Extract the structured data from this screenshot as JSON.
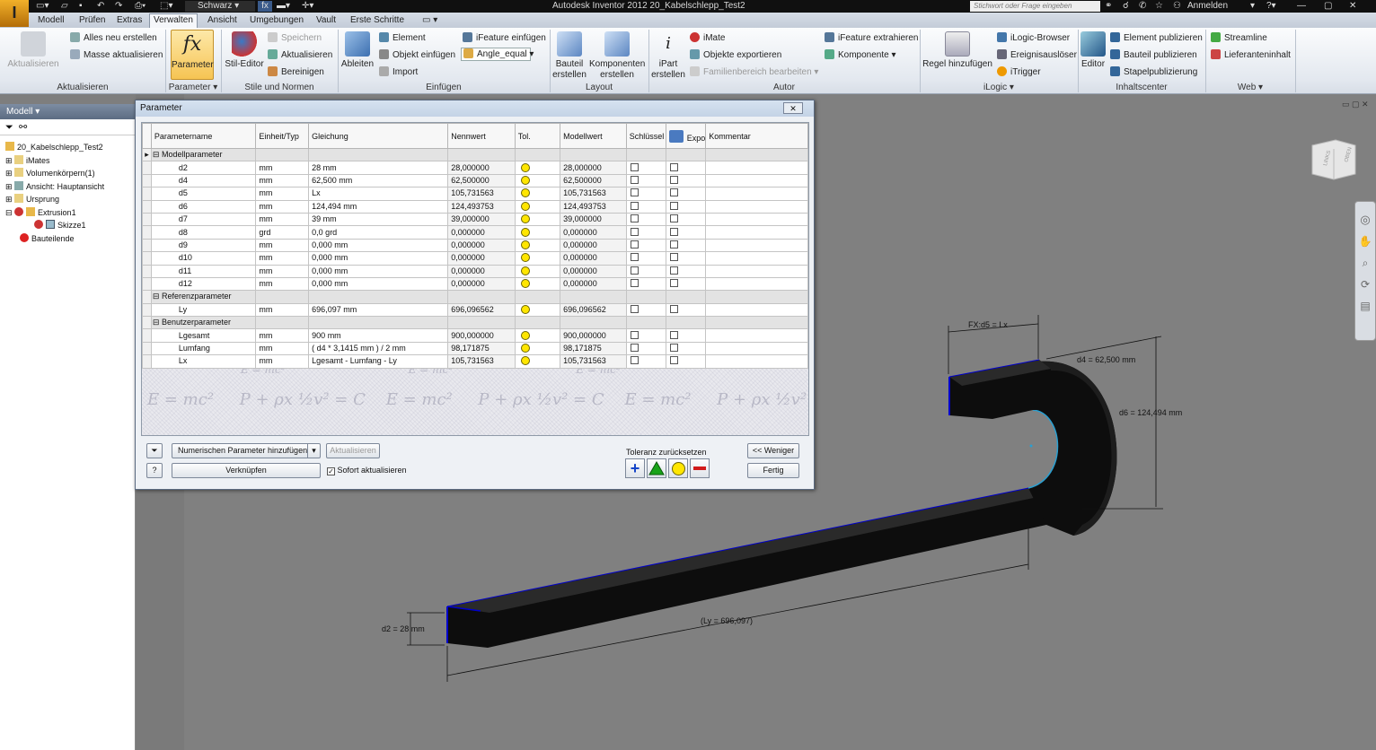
{
  "window": {
    "title": "Autodesk Inventor 2012  20_Kabelschlepp_Test2",
    "search_placeholder": "Stichwort oder Frage eingeben",
    "signin": "Anmelden"
  },
  "quick_access": {
    "color_value": "Schwarz"
  },
  "tabs": [
    {
      "label": "Modell"
    },
    {
      "label": "Prüfen"
    },
    {
      "label": "Extras"
    },
    {
      "label": "Verwalten"
    },
    {
      "label": "Ansicht"
    },
    {
      "label": "Umgebungen"
    },
    {
      "label": "Vault"
    },
    {
      "label": "Erste Schritte"
    }
  ],
  "ribbon": {
    "aktualisieren": {
      "big": "Aktualisieren",
      "alles": "Alles neu erstellen",
      "masse": "Masse aktualisieren",
      "group": "Aktualisieren"
    },
    "parameter": {
      "big": "Parameter",
      "group": "Parameter"
    },
    "stile": {
      "big": "Stil-Editor",
      "speichern": "Speichern",
      "aktualisieren": "Aktualisieren",
      "bereinigen": "Bereinigen",
      "group": "Stile und Normen"
    },
    "einfuegen": {
      "big": "Ableiten",
      "element": "Element",
      "objekt": "Objekt einfügen",
      "import": "Import",
      "ifeature": "iFeature einfügen",
      "angle": "Angle_equal",
      "group": "Einfügen"
    },
    "layout": {
      "bauteil": "Bauteil\nerstellen",
      "komponenten": "Komponenten\nerstellen",
      "group": "Layout"
    },
    "autor": {
      "ipart": "iPart\nerstellen",
      "imate": "iMate",
      "objekte": "Objekte exportieren",
      "familien": "Familienbereich bearbeiten",
      "ifeature_ex": "iFeature extrahieren",
      "komponente": "Komponente",
      "group": "Autor"
    },
    "ilogic": {
      "regel": "Regel hinzufügen",
      "browser": "iLogic-Browser",
      "ereignis": "Ereignisauslöser",
      "itrigger": "iTrigger",
      "group": "iLogic"
    },
    "inhalt": {
      "editor": "Editor",
      "element_pub": "Element publizieren",
      "bauteil_pub": "Bauteil publizieren",
      "stapel": "Stapelpublizierung",
      "group": "Inhaltscenter"
    },
    "web": {
      "streamline": "Streamline",
      "liefer": "Lieferanteninhalt",
      "group": "Web"
    }
  },
  "browser": {
    "header": "Modell",
    "items": [
      {
        "label": "20_Kabelschlepp_Test2"
      },
      {
        "label": "iMates"
      },
      {
        "label": "Volumenkörpern(1)"
      },
      {
        "label": "Ansicht: Hauptansicht"
      },
      {
        "label": "Ursprung"
      },
      {
        "label": "Extrusion1"
      },
      {
        "label": "Skizze1"
      },
      {
        "label": "Bauteilende"
      }
    ]
  },
  "dialog": {
    "title": "Parameter",
    "columns": [
      "Parametername",
      "Einheit/Typ",
      "Gleichung",
      "Nennwert",
      "Tol.",
      "Modellwert",
      "Schlüssel",
      "Expo",
      "Kommentar"
    ],
    "groups": {
      "modell": "Modellparameter",
      "referenz": "Referenzparameter",
      "benutzer": "Benutzerparameter"
    },
    "modell_rows": [
      {
        "name": "d2",
        "unit": "mm",
        "eq": "28 mm",
        "nenn": "28,000000",
        "model": "28,000000"
      },
      {
        "name": "d4",
        "unit": "mm",
        "eq": "62,500 mm",
        "nenn": "62,500000",
        "model": "62,500000"
      },
      {
        "name": "d5",
        "unit": "mm",
        "eq": "Lx",
        "nenn": "105,731563",
        "model": "105,731563"
      },
      {
        "name": "d6",
        "unit": "mm",
        "eq": "124,494 mm",
        "nenn": "124,493753",
        "model": "124,493753"
      },
      {
        "name": "d7",
        "unit": "mm",
        "eq": "39 mm",
        "nenn": "39,000000",
        "model": "39,000000"
      },
      {
        "name": "d8",
        "unit": "grd",
        "eq": "0,0 grd",
        "nenn": "0,000000",
        "model": "0,000000"
      },
      {
        "name": "d9",
        "unit": "mm",
        "eq": "0,000 mm",
        "nenn": "0,000000",
        "model": "0,000000"
      },
      {
        "name": "d10",
        "unit": "mm",
        "eq": "0,000 mm",
        "nenn": "0,000000",
        "model": "0,000000"
      },
      {
        "name": "d11",
        "unit": "mm",
        "eq": "0,000 mm",
        "nenn": "0,000000",
        "model": "0,000000"
      },
      {
        "name": "d12",
        "unit": "mm",
        "eq": "0,000 mm",
        "nenn": "0,000000",
        "model": "0,000000"
      }
    ],
    "referenz_rows": [
      {
        "name": "Ly",
        "unit": "mm",
        "eq": "696,097 mm",
        "nenn": "696,096562",
        "model": "696,096562"
      }
    ],
    "benutzer_rows": [
      {
        "name": "Lgesamt",
        "unit": "mm",
        "eq": "900 mm",
        "nenn": "900,000000",
        "model": "900,000000"
      },
      {
        "name": "Lumfang",
        "unit": "mm",
        "eq": "( d4 * 3,1415 mm ) / 2 mm",
        "nenn": "98,171875",
        "model": "98,171875"
      },
      {
        "name": "Lx",
        "unit": "mm",
        "eq": "Lgesamt - Lumfang - Ly",
        "nenn": "105,731563",
        "model": "105,731563"
      }
    ],
    "add_numeric": "Numerischen Parameter hinzufügen",
    "update": "Aktualisieren",
    "link": "Verknüpfen",
    "auto_update": "Sofort aktualisieren",
    "tol_reset": "Toleranz zurücksetzen",
    "less": "<< Weniger",
    "done": "Fertig"
  },
  "viewport": {
    "dim_fx": "FX:d5 = Lx",
    "dim_d4": "d4 = 62,500 mm",
    "dim_d6": "d6 = 124,494 mm",
    "dim_d2": "d2 = 28 mm",
    "dim_ly": "(Ly = 696,097)",
    "viewcube_left": "LINKS",
    "viewcube_top": "OBEN"
  }
}
